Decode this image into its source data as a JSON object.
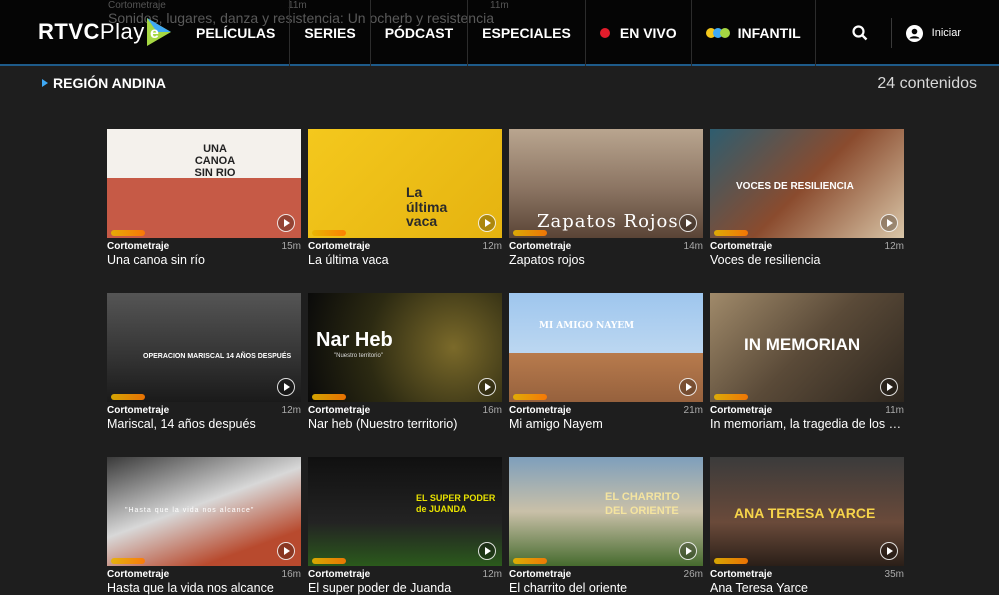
{
  "brand": {
    "logo_text": "RTVC",
    "logo_text2": "Play",
    "accent": "#3fa9f5",
    "live_color": "#e21c2b"
  },
  "ghost": {
    "text": "Sonidos, lugares, danza y resistencia: Un ocherb y resistencia",
    "meta_left": "Cortometraje",
    "meta_mid": "11m",
    "meta_right": "11m"
  },
  "nav": {
    "items": [
      "PELÍCULAS",
      "SERIES",
      "PÓDCAST",
      "ESPECIALES",
      "EN VIVO",
      "INFANTIL"
    ],
    "search_icon": "search-icon",
    "login_label": "Iniciar"
  },
  "section": {
    "title": "REGIÓN ANDINA",
    "count": "24 contenidos"
  },
  "cards": [
    {
      "category": "Cortometraje",
      "duration": "15m",
      "title": "Una canoa sin río",
      "thumb_text": "UNA CANOA SIN RIO"
    },
    {
      "category": "Cortometraje",
      "duration": "12m",
      "title": "La última vaca",
      "thumb_text": "La última vaca"
    },
    {
      "category": "Cortometraje",
      "duration": "14m",
      "title": "Zapatos rojos",
      "thumb_text": "Zapatos Rojos"
    },
    {
      "category": "Cortometraje",
      "duration": "12m",
      "title": "Voces de resiliencia",
      "thumb_text": "VOCES DE RESILIENCIA"
    },
    {
      "category": "Cortometraje",
      "duration": "12m",
      "title": "Mariscal, 14 años después",
      "thumb_text": "OPERACION MARISCAL 14 AÑOS DESPUÉS"
    },
    {
      "category": "Cortometraje",
      "duration": "16m",
      "title": "Nar heb (Nuestro territorio)",
      "thumb_text": "Nar Heb",
      "thumb_sub": "\"Nuestro territorio\""
    },
    {
      "category": "Cortometraje",
      "duration": "21m",
      "title": "Mi amigo Nayem",
      "thumb_text": "MI AMIGO NAYEM"
    },
    {
      "category": "Cortometraje",
      "duration": "11m",
      "title": "In memoriam, la tragedia de los d...",
      "thumb_text": "IN MEMORIAN"
    },
    {
      "category": "Cortometraje",
      "duration": "16m",
      "title": "Hasta que la vida nos alcance",
      "thumb_text": "\"Hasta que la vida nos alcance\""
    },
    {
      "category": "Cortometraje",
      "duration": "12m",
      "title": "El super poder de Juanda",
      "thumb_text": "EL SUPER PODER de JUANDA"
    },
    {
      "category": "Cortometraje",
      "duration": "26m",
      "title": "El charrito del oriente",
      "thumb_text": "EL CHARRITO DEL ORIENTE"
    },
    {
      "category": "Cortometraje",
      "duration": "35m",
      "title": "Ana Teresa Yarce",
      "thumb_text": "ANA TERESA YARCE"
    }
  ]
}
